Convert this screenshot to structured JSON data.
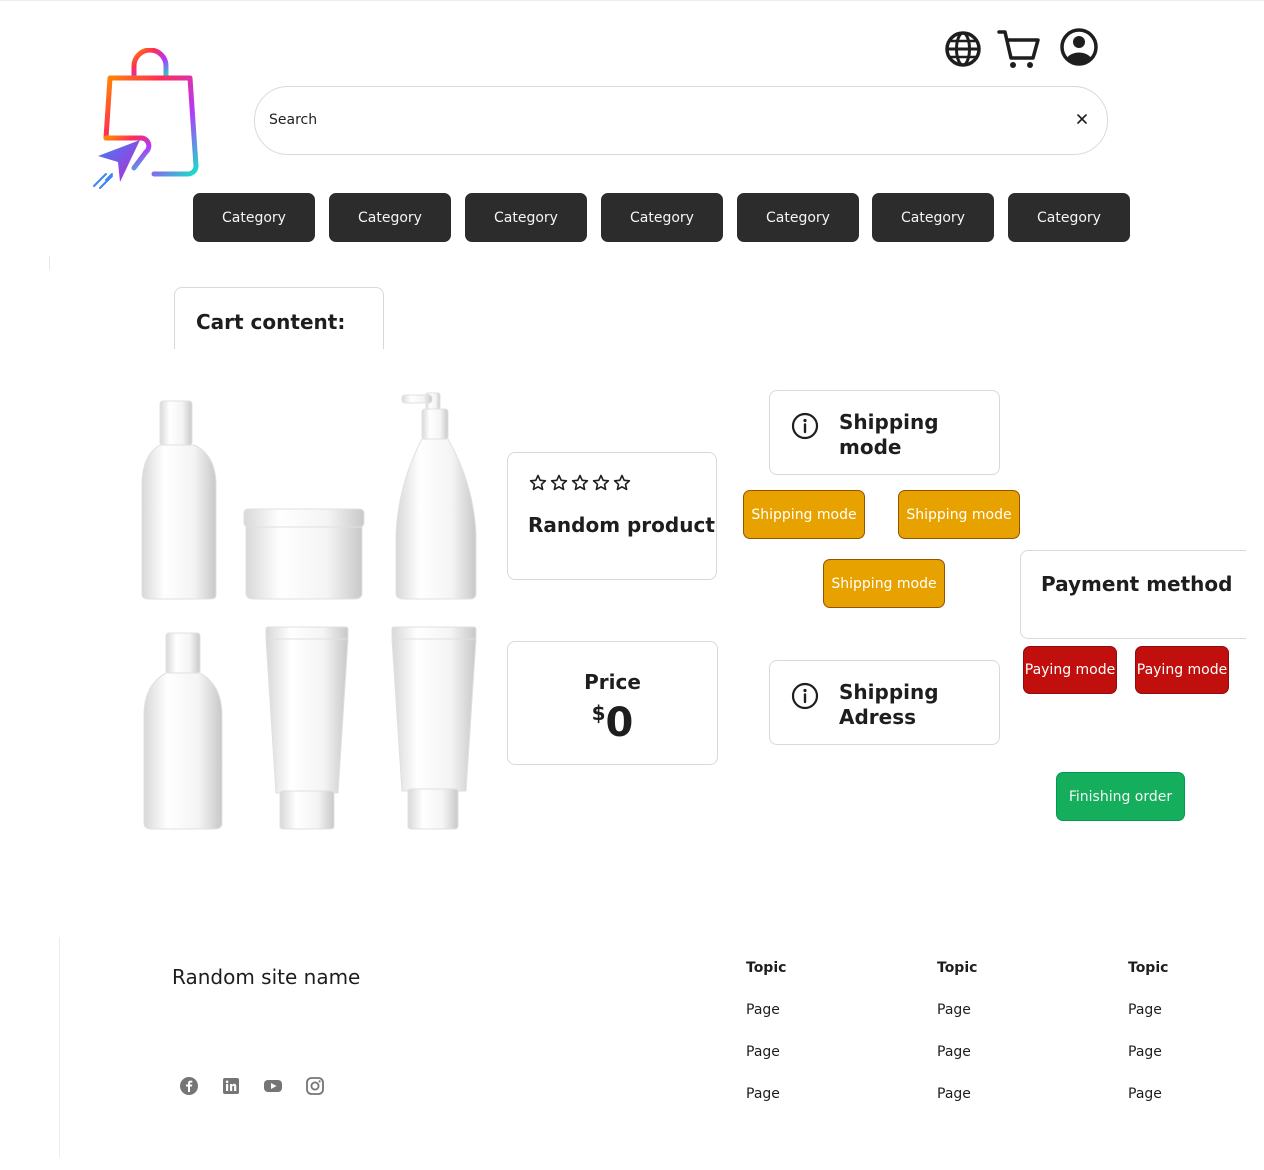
{
  "header": {
    "logo_icon": "shopping-bag-logo",
    "icons": [
      "globe-icon",
      "cart-icon",
      "user-icon"
    ],
    "search": {
      "placeholder": "Search",
      "clear_icon": "close-icon"
    }
  },
  "categories": [
    "Category",
    "Category",
    "Category",
    "Category",
    "Category",
    "Category",
    "Category"
  ],
  "cart": {
    "title": "Cart content:"
  },
  "product": {
    "image": "cosmetics-bottles-image",
    "rating_icon": "star-outline-icon",
    "rating": "0 of 5",
    "name": "Random product"
  },
  "price": {
    "label": "Price",
    "currency": "$",
    "value": "0"
  },
  "shipping": {
    "title": "Shipping mode",
    "options": [
      "Shipping mode",
      "Shipping mode",
      "Shipping mode"
    ],
    "address_title": "Shipping Adress"
  },
  "payment": {
    "title": "Payment method",
    "options": [
      "Paying mode",
      "Paying mode"
    ]
  },
  "finish_label": "Finishing order",
  "colors": {
    "category_bg": "#2c2c2c",
    "shipping_bg": "#e8a200",
    "paying_bg": "#c00f0c",
    "finish_bg": "#14ae5c"
  },
  "footer": {
    "site_name": "Random site name",
    "social_icons": [
      "facebook-icon",
      "linkedin-icon",
      "youtube-icon",
      "instagram-icon"
    ],
    "columns": [
      {
        "topic": "Topic",
        "pages": [
          "Page",
          "Page",
          "Page"
        ]
      },
      {
        "topic": "Topic",
        "pages": [
          "Page",
          "Page",
          "Page"
        ]
      },
      {
        "topic": "Topic",
        "pages": [
          "Page",
          "Page",
          "Page"
        ]
      }
    ]
  }
}
